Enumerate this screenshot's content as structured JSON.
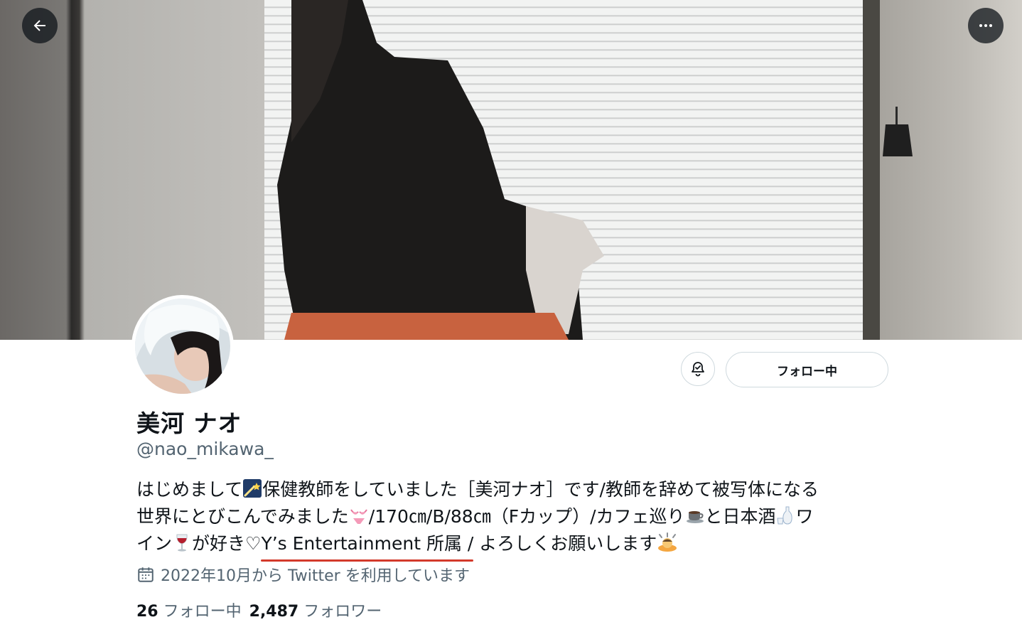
{
  "profile": {
    "display_name": "美河 ナオ",
    "handle": "@nao_mikawa_",
    "follow_button_label": "フォロー中",
    "bio": {
      "line1_a": "はじめまして",
      "line1_b": "保健教師をしていました［美河ナオ］です/教師を辞めて被写体になる",
      "line2_a": "世界にとびこんでみました",
      "line2_b": "/170㎝/B/88㎝（Fカップ）/カフェ巡り",
      "line2_c": "と日本酒",
      "line2_d": "ワ",
      "line3_a": "イン",
      "line3_b": "が好き♡",
      "line3_c": "Y’s Entertainment 所属 /",
      "line3_d": " よろしくお願いします"
    },
    "joined": "2022年10月から Twitter を利用しています",
    "following_count": "26",
    "following_label": "フォロー中",
    "followers_count": "2,487",
    "followers_label": "フォロワー"
  },
  "icons": {
    "back": "arrow-left-icon",
    "more": "more-horizontal-icon",
    "bell": "notification-bell-icon",
    "calendar": "calendar-icon"
  },
  "colors": {
    "text": "#0f1419",
    "muted": "#536471",
    "border": "#cfd9de",
    "underline": "#d33a2b"
  }
}
